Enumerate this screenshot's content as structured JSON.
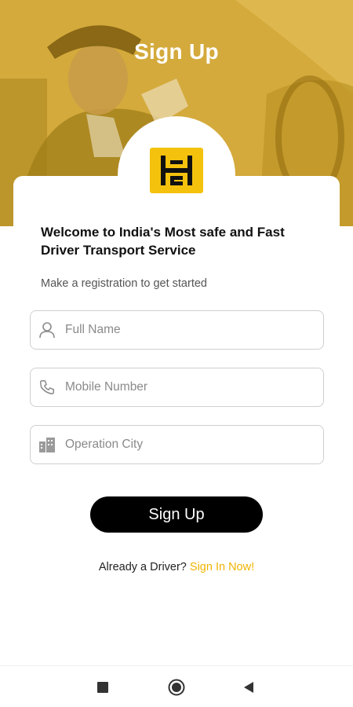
{
  "header": {
    "title": "Sign Up"
  },
  "logo": {
    "icon": "hc-logo-icon",
    "color": "#f4c20d"
  },
  "intro": {
    "welcome": "Welcome to India's Most safe and Fast Driver Transport Service",
    "subtitle": "Make a registration to get started"
  },
  "form": {
    "full_name": {
      "placeholder": "Full Name",
      "value": "",
      "icon": "person-icon"
    },
    "mobile": {
      "placeholder": "Mobile Number",
      "value": "",
      "icon": "phone-icon"
    },
    "city": {
      "placeholder": "Operation City",
      "value": "",
      "icon": "city-icon"
    }
  },
  "actions": {
    "signup_label": "Sign Up"
  },
  "footer": {
    "prompt": "Already a Driver? ",
    "link": "Sign In Now!"
  },
  "colors": {
    "accent": "#f0b400",
    "button": "#000000"
  }
}
